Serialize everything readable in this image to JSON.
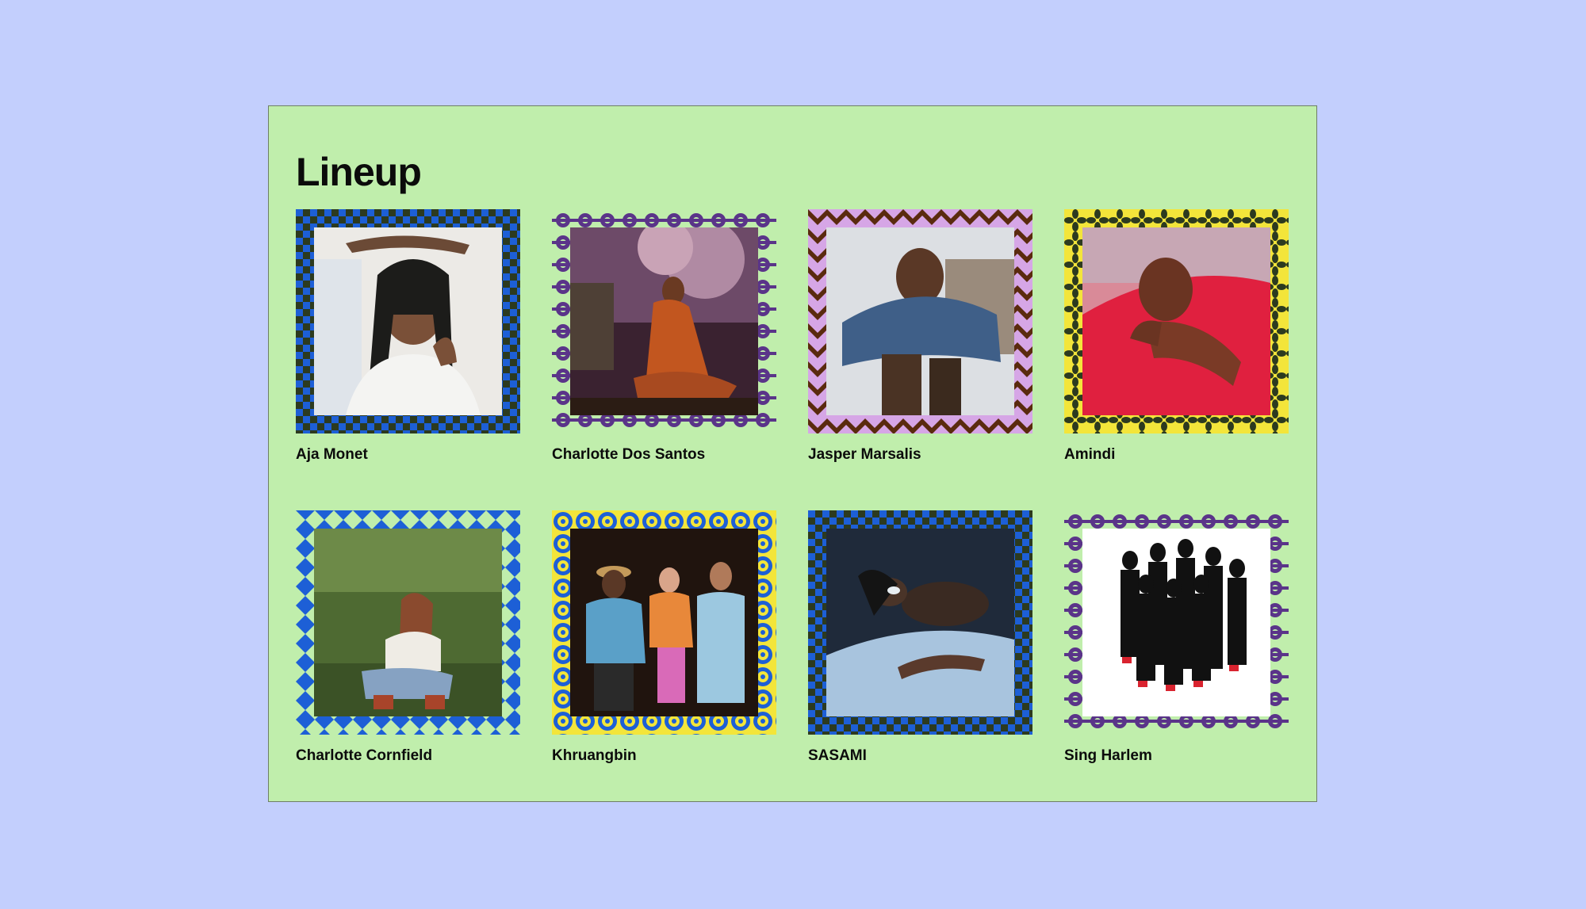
{
  "page": {
    "title": "Lineup"
  },
  "colors": {
    "background": "#c3cffd",
    "panel": "#c0eeac",
    "text": "#0b0b0b"
  },
  "artists": [
    {
      "name": "Aja Monet",
      "frame_pattern": "checker",
      "frame_colors": [
        "#1d5fd6",
        "#2c3a1f"
      ],
      "photo_icon": "portrait-photo-icon"
    },
    {
      "name": "Charlotte Dos Santos",
      "frame_pattern": "ornament",
      "frame_colors": [
        "#5a3489",
        "#c0eeac"
      ],
      "photo_icon": "portrait-photo-icon"
    },
    {
      "name": "Jasper Marsalis",
      "frame_pattern": "zigzag",
      "frame_colors": [
        "#d6a6e6",
        "#5a2a0e"
      ],
      "photo_icon": "portrait-photo-icon"
    },
    {
      "name": "Amindi",
      "frame_pattern": "petals",
      "frame_colors": [
        "#f3e53a",
        "#2c3a1f"
      ],
      "photo_icon": "portrait-photo-icon"
    },
    {
      "name": "Charlotte Cornfield",
      "frame_pattern": "triangles",
      "frame_colors": [
        "#1d5fd6",
        "#c0eeac"
      ],
      "photo_icon": "portrait-photo-icon"
    },
    {
      "name": "Khruangbin",
      "frame_pattern": "circles",
      "frame_colors": [
        "#f3e53a",
        "#1d5fd6"
      ],
      "photo_icon": "group-photo-icon"
    },
    {
      "name": "SASAMI",
      "frame_pattern": "checker",
      "frame_colors": [
        "#1d5fd6",
        "#2c3a1f"
      ],
      "photo_icon": "portrait-photo-icon"
    },
    {
      "name": "Sing Harlem",
      "frame_pattern": "ornament",
      "frame_colors": [
        "#5a3489",
        "#c0eeac"
      ],
      "photo_icon": "group-photo-icon"
    }
  ]
}
